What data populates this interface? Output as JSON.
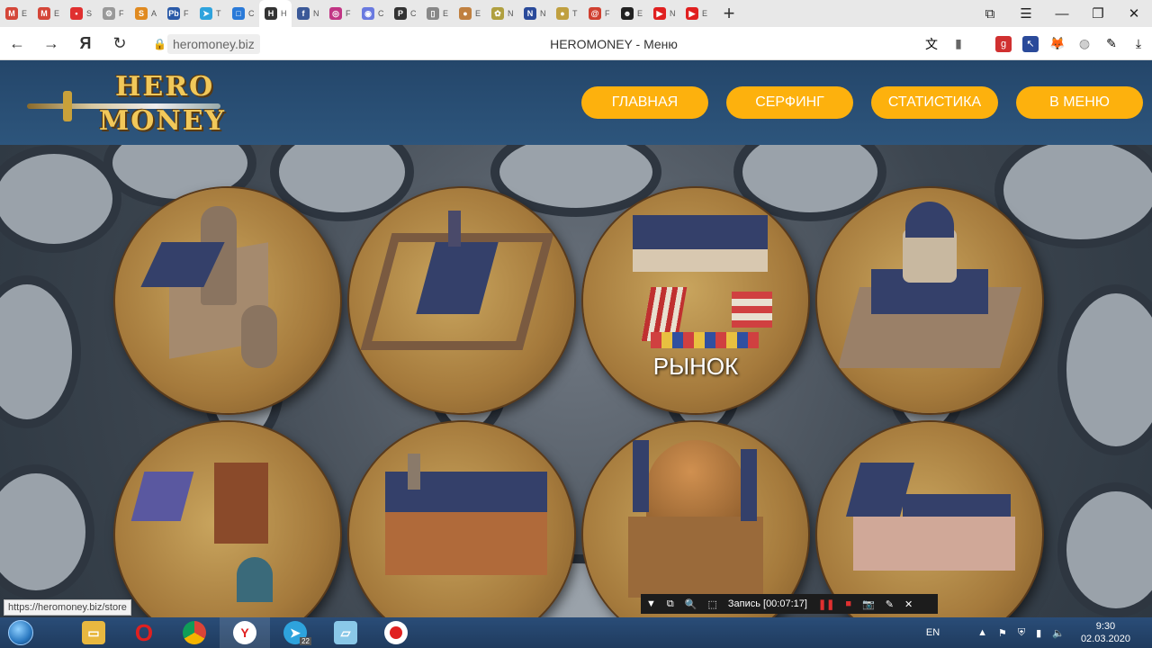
{
  "browser": {
    "tabs": [
      {
        "icon": "gmail-icon",
        "color": "#d44638",
        "letter": "M",
        "label": "E"
      },
      {
        "icon": "gmail-icon",
        "color": "#d44638",
        "letter": "M",
        "label": "E"
      },
      {
        "icon": "pin-icon",
        "color": "#e03030",
        "letter": "•",
        "label": "S"
      },
      {
        "icon": "gear-icon",
        "color": "#999999",
        "letter": "⚙",
        "label": "F"
      },
      {
        "icon": "shape-icon",
        "color": "#e08a20",
        "letter": "S",
        "label": "A"
      },
      {
        "icon": "pb-icon",
        "color": "#2a5aa8",
        "letter": "Pb",
        "label": "F"
      },
      {
        "icon": "telegram-icon",
        "color": "#2ea3dd",
        "letter": "➤",
        "label": "T"
      },
      {
        "icon": "chat-icon",
        "color": "#2a7ad8",
        "letter": "□",
        "label": "C"
      },
      {
        "icon": "hero-icon",
        "color": "#333333",
        "letter": "H",
        "label": "H",
        "active": true
      },
      {
        "icon": "facebook-icon",
        "color": "#3b5998",
        "letter": "f",
        "label": "N"
      },
      {
        "icon": "instagram-icon",
        "color": "#c13584",
        "letter": "◎",
        "label": "F"
      },
      {
        "icon": "discord-icon",
        "color": "#6a7ae0",
        "letter": "◉",
        "label": "C"
      },
      {
        "icon": "p-icon",
        "color": "#333333",
        "letter": "P",
        "label": "C"
      },
      {
        "icon": "doc-icon",
        "color": "#888888",
        "letter": "▯",
        "label": "E"
      },
      {
        "icon": "egg-icon",
        "color": "#c08040",
        "letter": "●",
        "label": "E"
      },
      {
        "icon": "flower-icon",
        "color": "#b0a040",
        "letter": "✿",
        "label": "N"
      },
      {
        "icon": "n-icon",
        "color": "#2a4a9a",
        "letter": "N",
        "label": "N"
      },
      {
        "icon": "coin-icon",
        "color": "#c0a040",
        "letter": "●",
        "label": "T"
      },
      {
        "icon": "swirl-icon",
        "color": "#d04030",
        "letter": "@",
        "label": "F"
      },
      {
        "icon": "face-icon",
        "color": "#222222",
        "letter": "☻",
        "label": "E"
      },
      {
        "icon": "youtube-icon",
        "color": "#e02020",
        "letter": "▶",
        "label": "N"
      },
      {
        "icon": "youtube-icon",
        "color": "#e02020",
        "letter": "▶",
        "label": "E"
      }
    ],
    "address": {
      "url": "heromoney.biz",
      "title": "HEROMONEY - Меню"
    },
    "status_url": "https://heromoney.biz/store"
  },
  "site": {
    "logo": {
      "line1": "HERO",
      "line2": "MONEY"
    },
    "menu": [
      {
        "label": "ГЛАВНАЯ"
      },
      {
        "label": "СЕРФИНГ"
      },
      {
        "label": "СТАТИСТИКА"
      },
      {
        "label": "В МЕНЮ"
      }
    ],
    "buildings": [
      {
        "name": "castle"
      },
      {
        "name": "fortress"
      },
      {
        "name": "market",
        "label": "РЫНОК"
      },
      {
        "name": "capitol"
      },
      {
        "name": "tavern"
      },
      {
        "name": "mansion"
      },
      {
        "name": "dome-hall"
      },
      {
        "name": "guild-house"
      }
    ]
  },
  "recorder": {
    "label": "Запись [00:07:17]"
  },
  "taskbar": {
    "lang": "EN",
    "time": "9:30",
    "date": "02.03.2020",
    "telegram_badge": "22"
  }
}
